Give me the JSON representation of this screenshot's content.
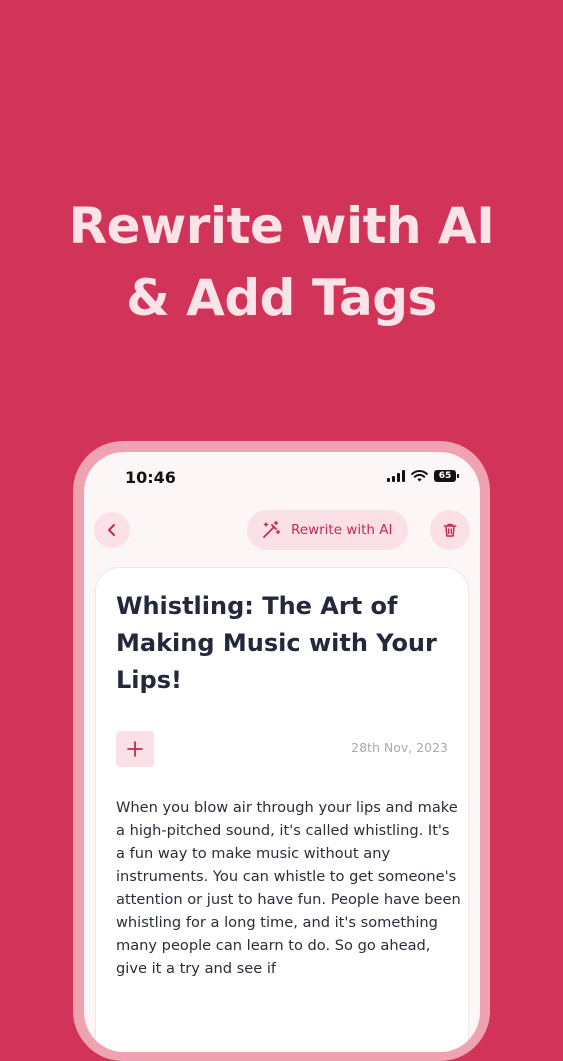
{
  "promo": {
    "headline_line1": "Rewrite with AI",
    "headline_line2": "& Add Tags"
  },
  "status_bar": {
    "time": "10:46",
    "battery": "65"
  },
  "toolbar": {
    "back_icon": "chevron-left-icon",
    "rewrite_label": "Rewrite with AI",
    "rewrite_icon": "magic-wand-icon",
    "delete_icon": "trash-icon"
  },
  "note": {
    "title": "Whistling: The Art of Making Music with Your Lips!",
    "add_tag_icon": "plus-icon",
    "date": "28th Nov, 2023",
    "body": "When you blow air through your lips and make a high-pitched sound, it's called whistling. It's a fun way to make music without any instruments. You can whistle to get someone's attention or just to have fun. People have been whistling for a long time, and it's something many people can learn to do. So go ahead, give it a try and see if"
  },
  "colors": {
    "background": "#D13458",
    "accent": "#C42A50",
    "accent_soft": "#FBE1E7",
    "headline": "#FBE3E8",
    "title_text": "#23283A"
  }
}
